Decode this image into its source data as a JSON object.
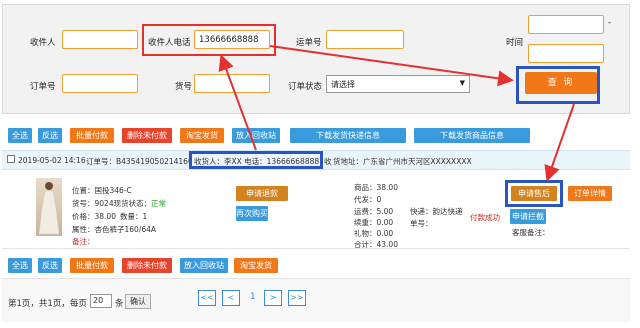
{
  "search": {
    "receiver_label": "收件人",
    "receiver_phone_label": "收件人电话",
    "receiver_phone_value": "13666668888",
    "waybill_label": "运单号",
    "time_label": "时间",
    "time_dash": "-",
    "order_no_label": "订单号",
    "item_no_label": "货号",
    "order_status_label": "订单状态",
    "order_status_value": "请选择",
    "query_label": "查 询"
  },
  "toolbar": {
    "select_all": "全选",
    "invert": "反选",
    "batch_pay": "批量付款",
    "delete_unpaid": "删除未付款",
    "taobao_ship": "淘宝发货",
    "recycle_bin": "放入回收站",
    "download_express": "下载发货快递信息",
    "download_goods": "下载发货商品信息"
  },
  "order": {
    "date": "2019-05-02 14:16",
    "order_no": "订单号：B4354190502141605",
    "consignee": "收货人：李XX 电话：13666668888",
    "address_prefix": "收",
    "address": "货地址：广东省广州市天河区XXXXXXXX",
    "position": "位置：国投346-C",
    "item_no": "货号：9024现货状态：",
    "stock_status": "正常",
    "price": "价格：38.00",
    "qty": "数量：1",
    "attr": "属性：杏色裤子160/64A",
    "note": "备注：",
    "refund_btn": "申请退款",
    "rebuy_btn": "再次购买",
    "goods": "商品：38.00",
    "agent": "代发：0",
    "freight": "运费：5.00",
    "renew": "续重：0.00",
    "gift": "礼物：0.00",
    "total": "合计：43.00",
    "express": "快递：韵达快递",
    "waybill": "单号：",
    "pay_status": "付款成功",
    "aftersale_btn": "申请售后",
    "detail_btn": "订单详情",
    "block_btn": "申请拦截",
    "service_note": "客服备注："
  },
  "pager": {
    "info_prefix": "第1页，共1页，每页",
    "per_page": "20",
    "unit": "条",
    "confirm": "确认",
    "first": "<<",
    "prev": "<",
    "current": "1",
    "next": ">",
    "last": ">>"
  },
  "colors": {
    "annotation_red": "#e53030",
    "annotation_blue": "#2a55c0",
    "button_orange": "#f07818",
    "button_blue": "#3a9bdc"
  }
}
